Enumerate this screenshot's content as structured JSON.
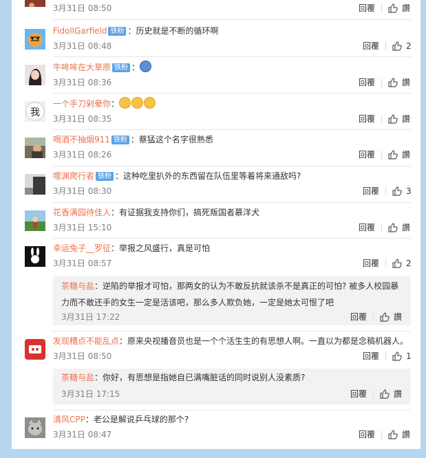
{
  "comments": [
    {
      "user": "",
      "badge": "",
      "text": "",
      "time": "3月31日 08:50",
      "reply": "回覆",
      "like": "讚",
      "avatar": "avatar"
    },
    {
      "user": "FidollGarfield",
      "badge": "铁粉",
      "text": "历史就是不断的循环啊",
      "time": "3月31日 08:48",
      "reply": "回覆",
      "like": "2",
      "avatar": "tiger-avatar"
    },
    {
      "user": "牛哞哞在大草原",
      "badge": "铁粉",
      "text": "",
      "time": "3月31日 08:36",
      "reply": "回覆",
      "like": "讚",
      "avatar": "girl-avatar"
    },
    {
      "user": "一个手刀剁晕你",
      "badge": "",
      "text": "",
      "time": "3月31日 08:35",
      "reply": "回覆",
      "like": "讚",
      "avatar": "me-avatar"
    },
    {
      "user": "喝酒不抽烟911",
      "badge": "铁粉",
      "text": "蔡猛这个名字很熟悉",
      "time": "3月31日 08:26",
      "reply": "回覆",
      "like": "讚",
      "avatar": "photo-avatar"
    },
    {
      "user": "噬渊爬行者",
      "badge": "铁粉",
      "text": "这种吃里扒外的东西留在队伍里等着将来通敌吗?",
      "time": "3月31日 08:30",
      "reply": "回覆",
      "like": "3",
      "avatar": "dark-avatar"
    },
    {
      "user": "花香满园待佳人",
      "badge": "",
      "text": "有证据我支持你们，搞死叛国者慕洋犬",
      "time": "3月31日 15:10",
      "reply": "回覆",
      "like": "讚",
      "avatar": "landscape-avatar"
    },
    {
      "user": "幸运兔子__罗征",
      "badge": "",
      "text": "举报之风盛行，真是可怕",
      "time": "3月31日 08:57",
      "reply": "回覆",
      "like": "2",
      "avatar": "rabbit-avatar"
    },
    {
      "user": "发现糟点不能乱点",
      "badge": "",
      "text": "原来央视播音员也是一个个活生生的有思想人啊。一直以为都是念稿机器人。",
      "time": "3月31日 08:50",
      "reply": "回覆",
      "like": "1",
      "avatar": "red-avatar"
    },
    {
      "user": "清风CPP",
      "badge": "",
      "text": "老公是解说乒乓球的那个?",
      "time": "3月31日 08:47",
      "reply": "回覆",
      "like": "讚",
      "avatar": "cat-avatar"
    }
  ],
  "subreplies": [
    {
      "user": "茶糖与盐",
      "text": "逆陷的举报才可怕，那两女的认为不敢反抗就该杀不是真正的可怕? 被多人校园暴力而不敢还手的女生一定是活该吧，那么多人欺负她，一定是她太可恨了吧",
      "time": "3月31日 17:22",
      "reply": "回覆",
      "like": "讚"
    },
    {
      "user": "茶糖与盐",
      "text": "你好，有思想是指她自已满嘴脏话的同时说别人没素质?",
      "time": "3月31日 17:15",
      "reply": "回覆",
      "like": "讚"
    }
  ],
  "colors": {
    "username": "#eb7350",
    "badge": "#5aa3e8",
    "background": "#b7d6ee"
  }
}
